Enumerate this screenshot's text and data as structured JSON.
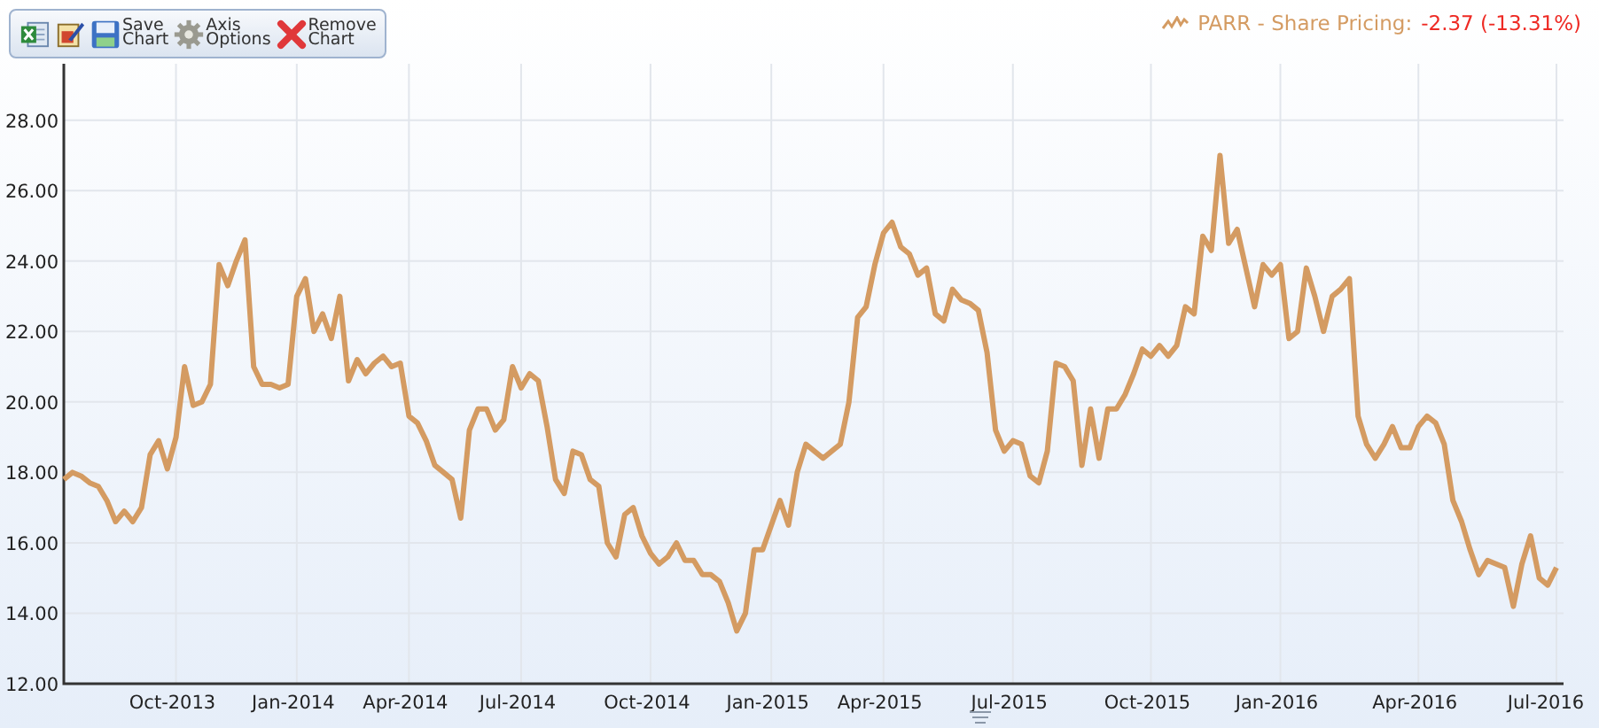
{
  "toolbar": {
    "buttons": [
      {
        "kind": "excel"
      },
      {
        "kind": "edit"
      },
      {
        "kind": "save",
        "label": "Save Chart"
      },
      {
        "kind": "axis",
        "label": "Axis Options"
      },
      {
        "kind": "remove",
        "label": "Remove Chart"
      }
    ]
  },
  "legend": {
    "change": "-2.37 (-13.31%)"
  },
  "chart": {
    "chart_data": {
      "type": "line",
      "grid": true,
      "categories": [
        null,
        null,
        null,
        null,
        null,
        null,
        null,
        null,
        null,
        null,
        null,
        null,
        null,
        "Oct-2013",
        null,
        null,
        null,
        null,
        null,
        null,
        null,
        null,
        null,
        null,
        null,
        null,
        null,
        "Jan-2014",
        null,
        null,
        null,
        null,
        null,
        null,
        null,
        null,
        null,
        null,
        null,
        null,
        "Apr-2014",
        null,
        null,
        null,
        null,
        null,
        null,
        null,
        null,
        null,
        null,
        null,
        null,
        "Jul-2014",
        null,
        null,
        null,
        null,
        null,
        null,
        null,
        null,
        null,
        null,
        null,
        null,
        null,
        null,
        "Oct-2014",
        null,
        null,
        null,
        null,
        null,
        null,
        null,
        null,
        null,
        null,
        null,
        null,
        null,
        "Jan-2015",
        null,
        null,
        null,
        null,
        null,
        null,
        null,
        null,
        null,
        null,
        null,
        null,
        "Apr-2015",
        null,
        null,
        null,
        null,
        null,
        null,
        null,
        null,
        null,
        null,
        null,
        null,
        null,
        null,
        "Jul-2015",
        null,
        null,
        null,
        null,
        null,
        null,
        null,
        null,
        null,
        null,
        null,
        null,
        null,
        null,
        null,
        "Oct-2015",
        null,
        null,
        null,
        null,
        null,
        null,
        null,
        null,
        null,
        null,
        null,
        null,
        null,
        null,
        "Jan-2016",
        null,
        null,
        null,
        null,
        null,
        null,
        null,
        null,
        null,
        null,
        null,
        null,
        null,
        null,
        null,
        "Apr-2016",
        null,
        null,
        null,
        null,
        null,
        null,
        null,
        null,
        null,
        null,
        null,
        null,
        null,
        null,
        null,
        "Jul-2016"
      ],
      "series": [
        {
          "name": "PARR - Share Pricing:",
          "color": "#d49b62",
          "values": [
            17.8,
            18.0,
            17.9,
            17.7,
            17.6,
            17.2,
            16.6,
            16.9,
            16.6,
            17.0,
            18.5,
            18.9,
            18.1,
            19.0,
            21.0,
            19.9,
            20.0,
            20.5,
            23.9,
            23.3,
            24.0,
            24.6,
            21.0,
            20.5,
            20.5,
            20.4,
            20.5,
            23.0,
            23.5,
            22.0,
            22.5,
            21.8,
            23.0,
            20.6,
            21.2,
            20.8,
            21.1,
            21.3,
            21.0,
            21.1,
            19.6,
            19.4,
            18.9,
            18.2,
            18.0,
            17.8,
            16.7,
            19.2,
            19.8,
            19.8,
            19.2,
            19.5,
            21.0,
            20.4,
            20.8,
            20.6,
            19.3,
            17.8,
            17.4,
            18.6,
            18.5,
            17.8,
            17.6,
            16.0,
            15.6,
            16.8,
            17.0,
            16.2,
            15.7,
            15.4,
            15.6,
            16.0,
            15.5,
            15.5,
            15.1,
            15.1,
            14.9,
            14.3,
            13.5,
            14.0,
            15.8,
            15.8,
            16.5,
            17.2,
            16.5,
            18.0,
            18.8,
            18.6,
            18.4,
            18.6,
            18.8,
            20.0,
            22.4,
            22.7,
            23.9,
            24.8,
            25.1,
            24.4,
            24.2,
            23.6,
            23.8,
            22.5,
            22.3,
            23.2,
            22.9,
            22.8,
            22.6,
            21.4,
            19.2,
            18.6,
            18.9,
            18.8,
            17.9,
            17.7,
            18.6,
            21.1,
            21.0,
            20.6,
            18.2,
            19.8,
            18.4,
            19.8,
            19.8,
            20.2,
            20.8,
            21.5,
            21.3,
            21.6,
            21.3,
            21.6,
            22.7,
            22.5,
            24.7,
            24.3,
            27.0,
            24.5,
            24.9,
            23.8,
            22.7,
            23.9,
            23.6,
            23.9,
            21.8,
            22.0,
            23.8,
            23.0,
            22.0,
            23.0,
            23.2,
            23.5,
            19.6,
            18.8,
            18.4,
            18.8,
            19.3,
            18.7,
            18.7,
            19.3,
            19.6,
            19.4,
            18.8,
            17.2,
            16.6,
            15.8,
            15.1,
            15.5,
            15.4,
            15.3,
            14.2,
            15.4,
            16.2,
            15.0,
            14.8,
            15.3
          ]
        }
      ],
      "ylim": [
        12,
        29.6
      ],
      "yticks": [
        {
          "value": 12,
          "label": "12.00"
        },
        {
          "value": 14,
          "label": "14.00"
        },
        {
          "value": 16,
          "label": "16.00"
        },
        {
          "value": 18,
          "label": "18.00"
        },
        {
          "value": 20,
          "label": "20.00"
        },
        {
          "value": 22,
          "label": "22.00"
        },
        {
          "value": 24,
          "label": "24.00"
        },
        {
          "value": 26,
          "label": "26.00"
        },
        {
          "value": 28,
          "label": "28.00"
        }
      ]
    }
  }
}
